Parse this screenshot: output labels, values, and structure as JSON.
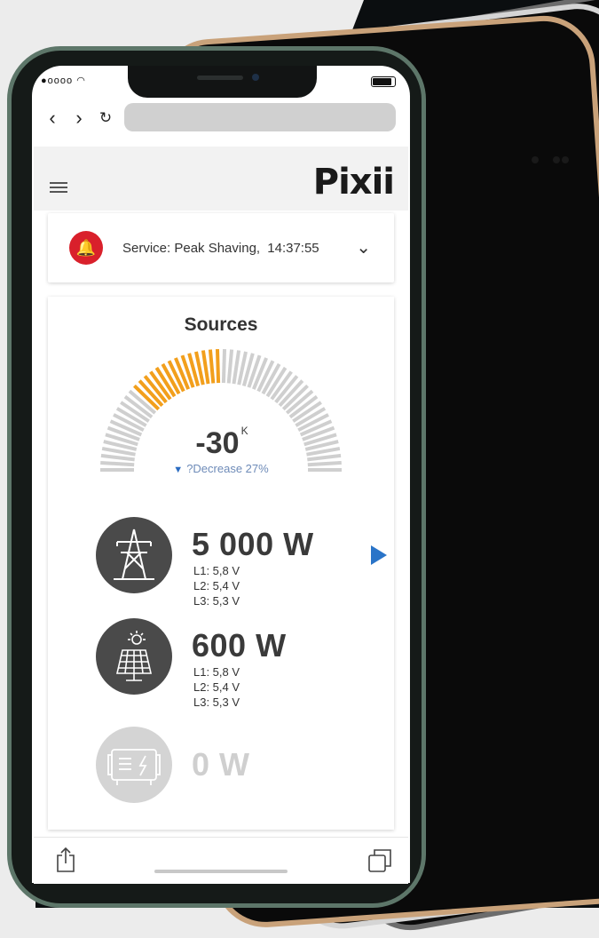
{
  "status_bar": {
    "signal": "●oooo"
  },
  "browser": {
    "back_icon": "chevron-left-icon",
    "forward_icon": "chevron-right-icon",
    "reload_icon": "reload-icon"
  },
  "header": {
    "logo": "Pixii"
  },
  "service": {
    "label": "Service: Peak Shaving,",
    "time": "14:37:55"
  },
  "sources": {
    "title": "Sources",
    "gauge": {
      "value": "-30",
      "unit": "K",
      "change": "?Decrease 27%",
      "filled_fraction": 0.27
    },
    "items": [
      {
        "power": "5 000 W",
        "lines": [
          "L1: 5,8 V",
          "L2: 5,4 V",
          "L3: 5,3 V"
        ]
      },
      {
        "power": "600 W",
        "lines": [
          "L1: 5,8 V",
          "L2: 5,4 V",
          "L3: 5,3 V"
        ]
      },
      {
        "power": "0 W",
        "lines": []
      }
    ]
  },
  "colors": {
    "accent_orange": "#f29f1c",
    "alert_red": "#d9202b",
    "blue": "#2a74c8"
  }
}
